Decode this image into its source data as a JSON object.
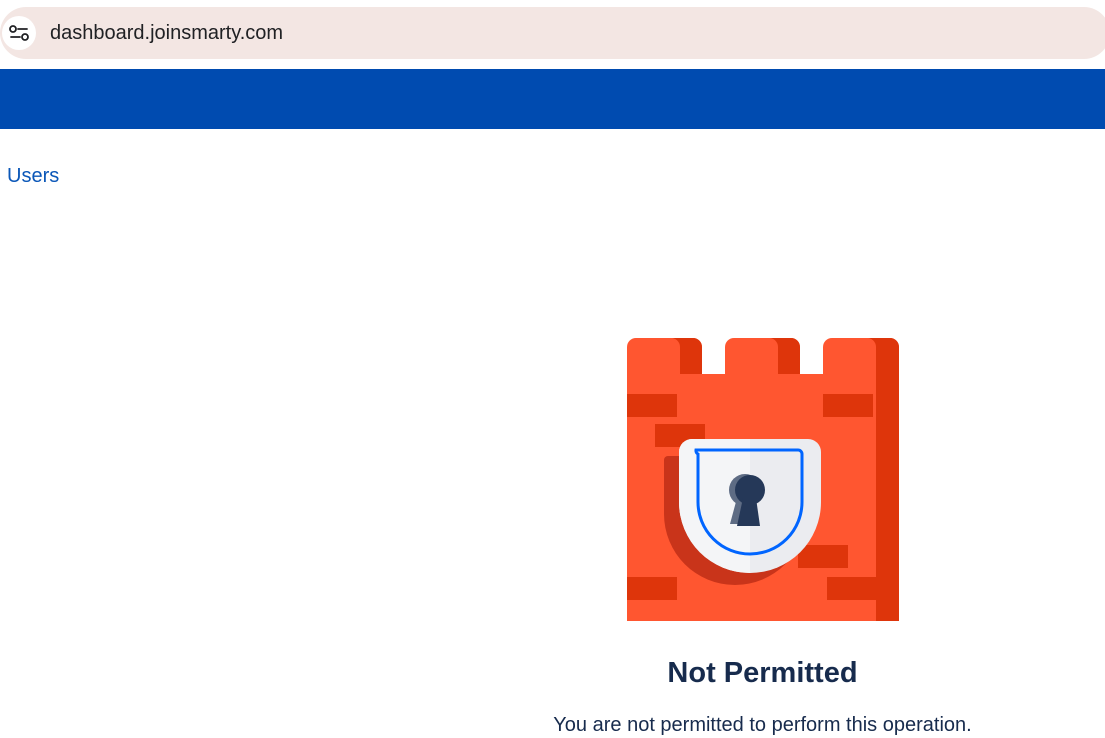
{
  "browser": {
    "url": "dashboard.joinsmarty.com",
    "site_info_icon": "tune-icon"
  },
  "colors": {
    "banner": "#004bb0",
    "link": "#0b57b8",
    "tower": "#ff5630",
    "tower_shade": "#de350b",
    "shield": "#ebecf0",
    "shield_outline": "#0065ff",
    "keyhole": "#253858",
    "text": "#172b4d"
  },
  "nav": {
    "breadcrumb_label": "Users"
  },
  "error": {
    "illustration_icon": "locked-tower-icon",
    "title": "Not Permitted",
    "message": "You are not permitted to perform this operation."
  }
}
